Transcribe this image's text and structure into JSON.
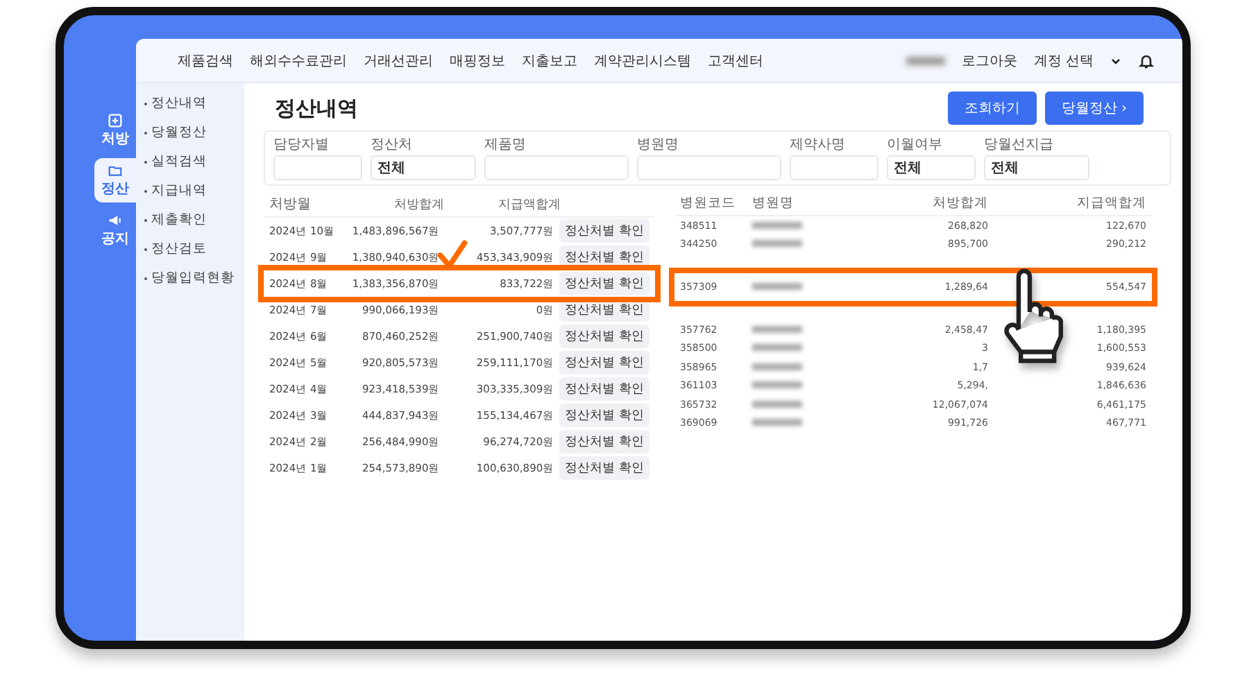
{
  "top_nav": {
    "items": [
      "제품검색",
      "해외수수료관리",
      "거래선관리",
      "매핑정보",
      "지출보고",
      "계약관리시스템",
      "고객센터"
    ],
    "logout": "로그아웃",
    "account": "계정 선택"
  },
  "rail": [
    {
      "label": "처방",
      "kind": "plus",
      "selected": false
    },
    {
      "label": "정산",
      "kind": "folder",
      "selected": true
    },
    {
      "label": "공지",
      "kind": "megaphone",
      "selected": false
    }
  ],
  "sidebar": {
    "items": [
      "정산내역",
      "당월정산",
      "실적검색",
      "지급내역",
      "제출확인",
      "정산검토",
      "당월입력현황"
    ]
  },
  "page_title": "정산내역",
  "actions": {
    "search": "조회하기",
    "monthly": "당월정산 ›"
  },
  "filters": [
    {
      "label": "담당자별"
    },
    {
      "label": "정산처",
      "value": "전체"
    },
    {
      "label": "제품명"
    },
    {
      "label": "병원명"
    },
    {
      "label": "제약사명"
    },
    {
      "label": "이월여부",
      "value": "전체"
    },
    {
      "label": "당월선지급",
      "value": "전체"
    }
  ],
  "monthly_table": {
    "columns": [
      "처방월",
      "처방합계",
      "지급액합계"
    ],
    "rows": [
      {
        "month": "2024년 10월",
        "total": "1,483,896,567원",
        "paid": "3,507,777원",
        "button": "정산처별 확인",
        "selected": false
      },
      {
        "month": "2024년 9월",
        "total": "1,380,940,630원",
        "paid": "453,343,909원",
        "button": "정산처별 확인",
        "selected": false
      },
      {
        "month": "2024년 8월",
        "total": "1,383,356,870원",
        "paid": "833,722원",
        "button": "정산처별 확인",
        "selected": true
      },
      {
        "month": "2024년 7월",
        "total": "990,066,193원",
        "paid": "0원",
        "button": "정산처별 확인",
        "selected": false
      },
      {
        "month": "2024년 6월",
        "total": "870,460,252원",
        "paid": "251,900,740원",
        "button": "정산처별 확인",
        "selected": false
      },
      {
        "month": "2024년 5월",
        "total": "920,805,573원",
        "paid": "259,111,170원",
        "button": "정산처별 확인",
        "selected": false
      },
      {
        "month": "2024년 4월",
        "total": "923,418,539원",
        "paid": "303,335,309원",
        "button": "정산처별 확인",
        "selected": false
      },
      {
        "month": "2024년 3월",
        "total": "444,837,943원",
        "paid": "155,134,467원",
        "button": "정산처별 확인",
        "selected": false
      },
      {
        "month": "2024년 2월",
        "total": "256,484,990원",
        "paid": "96,274,720원",
        "button": "정산처별 확인",
        "selected": false
      },
      {
        "month": "2024년 1월",
        "total": "254,573,890원",
        "paid": "100,630,890원",
        "button": "정산처별 확인",
        "selected": false
      }
    ]
  },
  "hospital_table": {
    "columns": [
      "병원코드",
      "병원명",
      "처방합계",
      "지급액합계"
    ],
    "rows": [
      {
        "code": "348511",
        "total": "268,820",
        "paid": "122,670",
        "selected": false
      },
      {
        "code": "344250",
        "total": "895,700",
        "paid": "290,212",
        "selected": false
      },
      {
        "code": "357309",
        "total": "1,289,64",
        "paid": "554,547",
        "selected": true
      },
      {
        "code": "357762",
        "total": "2,458,47",
        "paid": "1,180,395",
        "selected": false
      },
      {
        "code": "358500",
        "total": "3",
        "paid": "1,600,553",
        "selected": false
      },
      {
        "code": "358965",
        "total": "1,7",
        "paid": "939,624",
        "selected": false
      },
      {
        "code": "361103",
        "total": "5,294,",
        "paid": "1,846,636",
        "selected": false
      },
      {
        "code": "365732",
        "total": "12,067,074",
        "paid": "6,461,175",
        "selected": false
      },
      {
        "code": "369069",
        "total": "991,726",
        "paid": "467,771",
        "selected": false
      }
    ]
  }
}
